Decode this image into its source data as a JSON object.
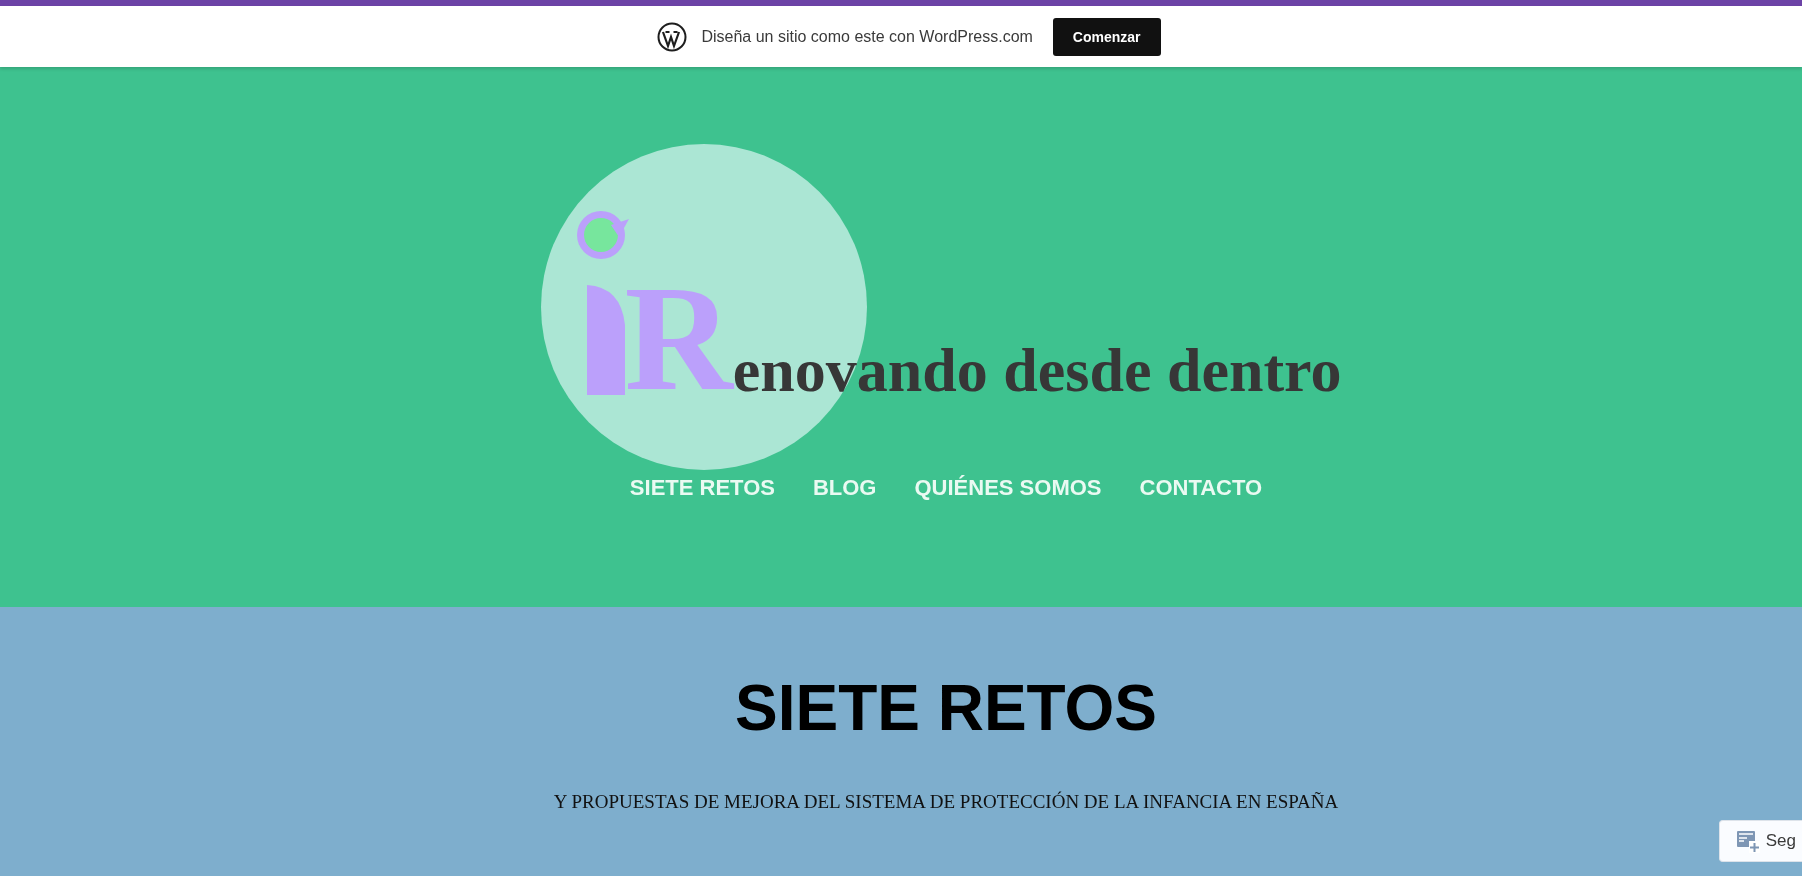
{
  "promo_bar": {
    "text": "Diseña un sitio como este con WordPress.com",
    "button": "Comenzar"
  },
  "logo": {
    "initial": "R",
    "rest": "enovando desde dentro"
  },
  "nav": [
    {
      "label": "SIETE RETOS"
    },
    {
      "label": "BLOG"
    },
    {
      "label": "QUIÉNES SOMOS"
    },
    {
      "label": "CONTACTO"
    }
  ],
  "page": {
    "title": "SIETE RETOS",
    "subtitle": "Y PROPUESTAS DE MEJORA DEL SISTEMA DE PROTECCIÓN DE LA INFANCIA EN ESPAÑA"
  },
  "follow_button": {
    "label": "Seg"
  }
}
